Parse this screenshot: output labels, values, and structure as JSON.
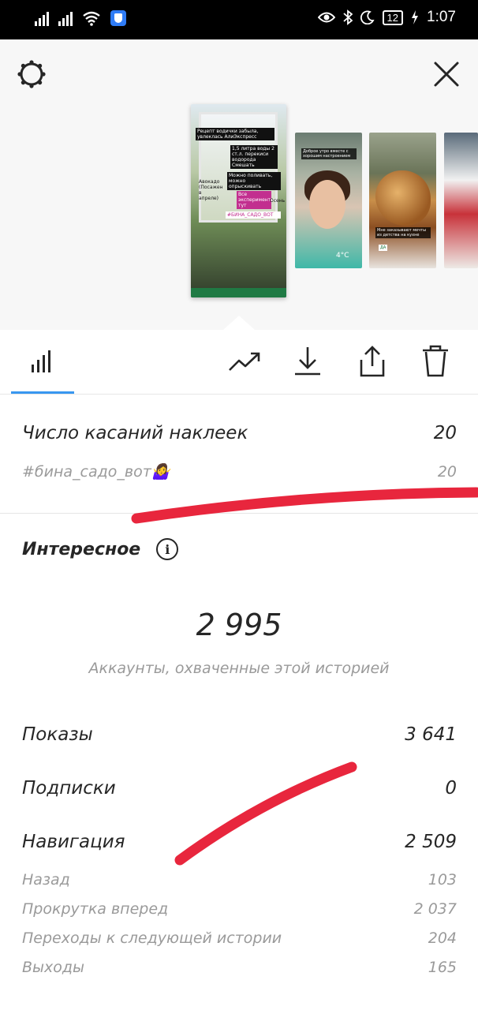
{
  "status_bar": {
    "battery": "12",
    "time": "1:07"
  },
  "colors": {
    "accent": "#3897f0",
    "annotation_marker": "#e8263d"
  },
  "icons": {
    "settings": "gear-icon",
    "close": "close-icon",
    "insights_tab": "bar-chart-icon",
    "promote": "trending-up-icon",
    "save": "download-icon",
    "share": "share-icon",
    "delete": "trash-icon"
  },
  "story_thumbnails": {
    "selected": {
      "captions": [
        "Рецепт водички забыла, увлеклась АлиЭкспресс",
        "1,5 литра воды 2 ст.л. перекиси водорода Смешать",
        "Можно поливать, можно опрыскивать",
        "Все эксперименты тут",
        "#БИНА_САДО_ВОТ",
        "Авокадо (Посажен в апреле)",
        "Осень"
      ]
    },
    "second": {
      "captions": [
        "Доброе утро вместе с хорошим настроением",
        "4°C"
      ]
    },
    "third": {
      "captions": [
        "Мне заказывают мечты из детства на кухне",
        "ДА"
      ]
    }
  },
  "sticker_taps": {
    "label": "Число касаний наклеек",
    "value": "20",
    "items": [
      {
        "label": "#бина_садо_вот🤷‍♀️",
        "value": "20"
      }
    ]
  },
  "discovery": {
    "title": "Интересное",
    "reach_value": "2 995",
    "reach_caption": "Аккаунты, охваченные этой историей",
    "metrics": [
      {
        "label": "Показы",
        "value": "3 641"
      },
      {
        "label": "Подписки",
        "value": "0"
      },
      {
        "label": "Навигация",
        "value": "2 509"
      }
    ],
    "navigation_items": [
      {
        "label": "Назад",
        "value": "103"
      },
      {
        "label": "Прокрутка вперед",
        "value": "2 037"
      },
      {
        "label": "Переходы к следующей истории",
        "value": "204"
      },
      {
        "label": "Выходы",
        "value": "165"
      }
    ]
  }
}
